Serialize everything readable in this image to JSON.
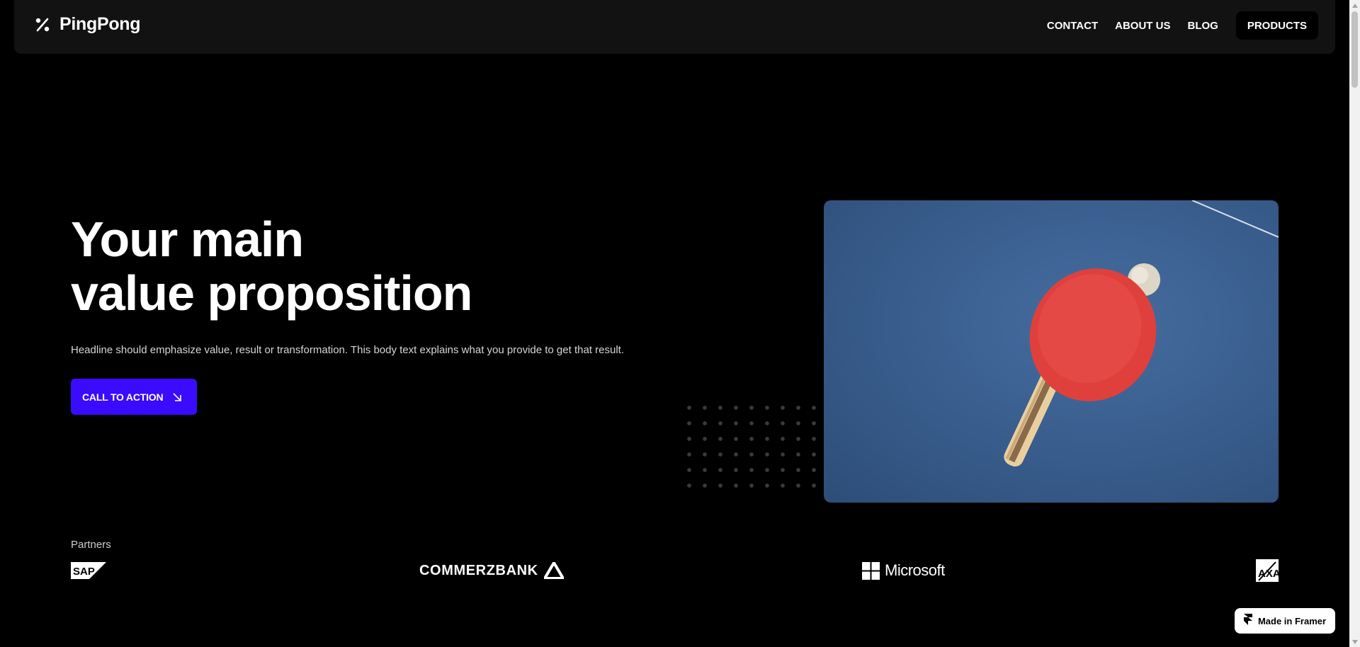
{
  "brand": {
    "name": "PingPong",
    "icon": "percent-icon"
  },
  "nav": {
    "contact": "CONTACT",
    "about": "ABOUT US",
    "blog": "BLOG",
    "products": "PRODUCTS"
  },
  "hero": {
    "title_line1": "Your main",
    "title_line2": "value proposition",
    "body": "Headline should emphasize value, result or transformation. This body text explains what you provide to get that result.",
    "cta_label": "CALL TO ACTION",
    "cta_icon": "arrow-down-right-icon"
  },
  "partners": {
    "label": "Partners",
    "logos": [
      "SAP",
      "COMMERZBANK",
      "Microsoft",
      "AXA"
    ],
    "commerzbank": "COMMERZBANK",
    "microsoft": "Microsoft"
  },
  "framer_badge": {
    "label": "Made in Framer",
    "icon": "framer-icon"
  },
  "colors": {
    "background": "#000000",
    "nav_bg": "#121212",
    "cta": "#3a0bff",
    "table_blue": "#3a5f8f",
    "paddle_red": "#e0403c"
  }
}
